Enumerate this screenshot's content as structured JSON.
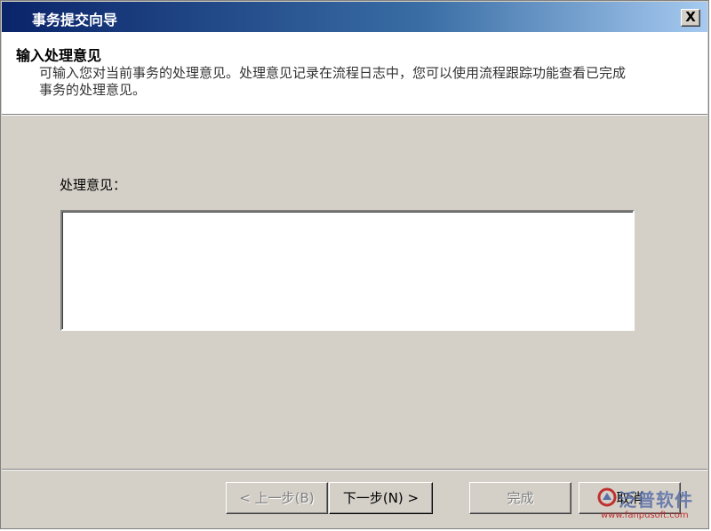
{
  "window": {
    "title": "事务提交向导",
    "close_label": "X"
  },
  "header": {
    "title": "输入处理意见",
    "description": "可输入您对当前事务的处理意见。处理意见记录在流程日志中，您可以使用流程跟踪功能查看已完成事务的处理意见。"
  },
  "form": {
    "opinion_label": "处理意见：",
    "opinion_value": ""
  },
  "buttons": {
    "back": "< 上一步(B)",
    "next": "下一步(N) >",
    "finish": "完成",
    "cancel": "取消"
  },
  "watermark": {
    "brand": "泛普软件",
    "url": "www.fanpusoft.com"
  }
}
